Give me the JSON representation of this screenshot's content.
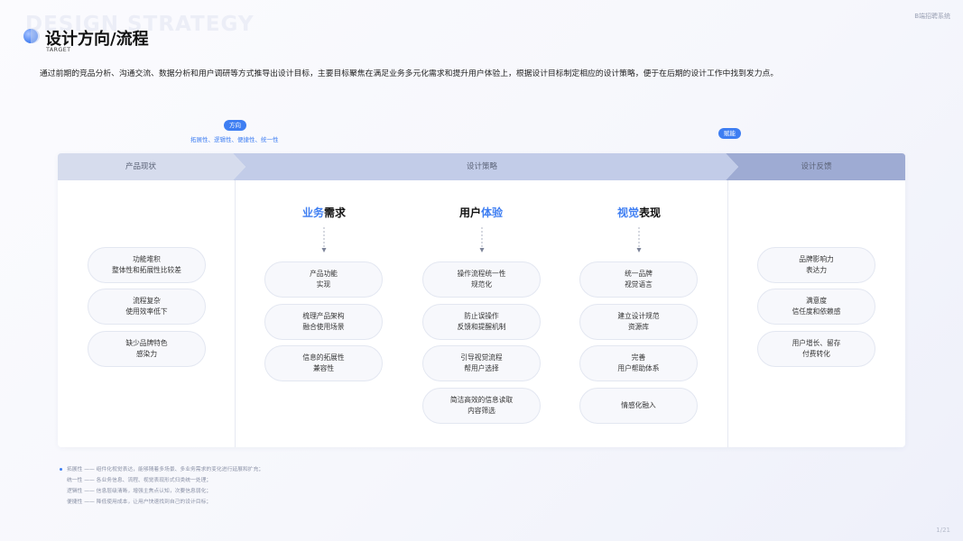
{
  "header": {
    "bg_title": "DESIGN STRATEGY",
    "title": "设计方向/流程",
    "subtitle": "TARGET",
    "brand": "B端招聘系统"
  },
  "intro": "通过前期的竞品分析、沟通交流、数据分析和用户调研等方式推导出设计目标，主要目标聚焦在满足业务多元化需求和提升用户体验上，根据设计目标制定相应的设计策略，便于在后期的设计工作中找到发力点。",
  "tags": {
    "direction": "方向",
    "direction_note": "拓展性、逻辑性、便捷性、统一性",
    "empower": "赋能"
  },
  "bands": {
    "current": "产品现状",
    "strategy": "设计策略",
    "feedback": "设计反馈"
  },
  "current_items": [
    {
      "l1": "功能堆积",
      "l2": "整体性和拓展性比较差"
    },
    {
      "l1": "流程复杂",
      "l2": "使用效率低下"
    },
    {
      "l1": "缺少品牌特色",
      "l2": "感染力"
    }
  ],
  "columns": [
    {
      "head_hl": "业务",
      "head_rest": "需求",
      "hl_first": true,
      "items": [
        {
          "l1": "产品功能",
          "l2": "实现"
        },
        {
          "l1": "梳理产品架构",
          "l2": "融合使用场景"
        },
        {
          "l1": "信息的拓展性",
          "l2": "兼容性"
        }
      ]
    },
    {
      "head_hl": "体验",
      "head_rest": "用户",
      "hl_first": false,
      "items": [
        {
          "l1": "操作流程统一性",
          "l2": "规范化"
        },
        {
          "l1": "防止误操作",
          "l2": "反馈和提醒机制"
        },
        {
          "l1": "引导视觉流程",
          "l2": "帮用户选择"
        },
        {
          "l1": "简洁高效的信息读取",
          "l2": "内容筛选"
        }
      ]
    },
    {
      "head_hl": "视觉",
      "head_rest": "表现",
      "hl_first": true,
      "items": [
        {
          "l1": "统一品牌",
          "l2": "视觉语言"
        },
        {
          "l1": "建立设计规范",
          "l2": "资源库"
        },
        {
          "l1": "完善",
          "l2": "用户帮助体系"
        },
        {
          "l1": "情感化融入",
          "l2": ""
        }
      ]
    }
  ],
  "feedback_items": [
    {
      "l1": "品牌影响力",
      "l2": "表达力"
    },
    {
      "l1": "满意度",
      "l2": "信任度和依赖感"
    },
    {
      "l1": "用户增长、留存",
      "l2": "付费转化"
    }
  ],
  "notes": [
    "拓展性 —— 组件化视觉表达，能够随着多场景、多业务需求的变化进行延展和扩充；",
    "统一性 —— 各业务信息、流程、视觉表现形式归类统一处理；",
    "逻辑性 —— 信息层级清晰，增强主焦点认知，次要信息弱化；",
    "便捷性 —— 降低使用成本，让用户快速找到自己的设计目标；"
  ],
  "page": "1/21",
  "colors": {
    "accent": "#3e7ef2",
    "band_light": "#d6dced",
    "band_mid": "#c2cce8",
    "band_dark": "#9eabd3"
  }
}
